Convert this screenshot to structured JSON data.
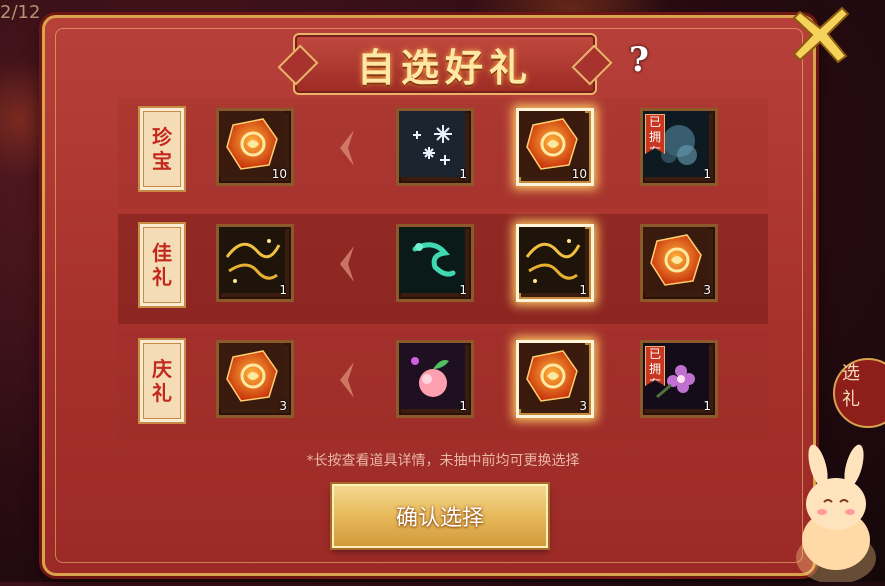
{
  "page": {
    "corner_text": "2/12"
  },
  "dialog": {
    "title": "自选好礼",
    "help_label": "?",
    "note": "*长按查看道具详情，未抽中前均可更换选择",
    "confirm_label": "确认选择",
    "owned_label": "已拥有",
    "side_badge_text": [
      "选",
      "礼"
    ]
  },
  "rows": [
    {
      "tag": [
        "珍",
        "宝"
      ],
      "selected": {
        "icon": "orange-gem-icon",
        "count": "10"
      },
      "options": [
        {
          "icon": "snowflake-icon",
          "count": "1",
          "owned": false
        },
        {
          "icon": "orange-gem-icon",
          "count": "10",
          "owned": false,
          "selected": true
        },
        {
          "icon": "blue-spirit-icon",
          "count": "1",
          "owned": true
        }
      ]
    },
    {
      "tag": [
        "佳",
        "礼"
      ],
      "selected": {
        "icon": "golden-swirl-icon",
        "count": "1"
      },
      "options": [
        {
          "icon": "jade-dragon-icon",
          "count": "1",
          "owned": false
        },
        {
          "icon": "golden-swirl-icon",
          "count": "1",
          "owned": false,
          "selected": true
        },
        {
          "icon": "orange-gem-icon",
          "count": "3",
          "owned": false
        }
      ]
    },
    {
      "tag": [
        "庆",
        "礼"
      ],
      "selected": {
        "icon": "orange-gem-icon",
        "count": "3"
      },
      "options": [
        {
          "icon": "peach-icon",
          "count": "1",
          "owned": false
        },
        {
          "icon": "orange-gem-icon",
          "count": "3",
          "owned": false,
          "selected": true
        },
        {
          "icon": "purple-flower-icon",
          "count": "1",
          "owned": true
        }
      ]
    }
  ],
  "colors": {
    "panel": "#a8322d",
    "gold": "#e7b56a",
    "title": "#ffe7a6",
    "selected_glow": "#ffcc66"
  }
}
